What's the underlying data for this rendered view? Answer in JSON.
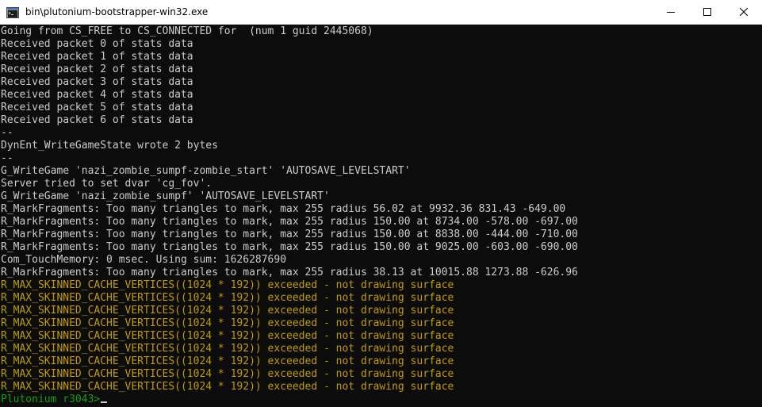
{
  "window": {
    "title": "bin\\plutonium-bootstrapper-win32.exe",
    "icon": "console-app-icon",
    "controls": {
      "minimize": "minimize-icon",
      "maximize": "maximize-icon",
      "close": "close-icon"
    }
  },
  "colors": {
    "background": "#0c0c0c",
    "text_default": "#cccccc",
    "text_warning": "#c19c00",
    "text_prompt": "#13a10e"
  },
  "console": {
    "lines": [
      {
        "text": "Going from CS_FREE to CS_CONNECTED for  (num 1 guid 2445068)",
        "style": "normal"
      },
      {
        "text": "Received packet 0 of stats data",
        "style": "normal"
      },
      {
        "text": "Received packet 1 of stats data",
        "style": "normal"
      },
      {
        "text": "Received packet 2 of stats data",
        "style": "normal"
      },
      {
        "text": "Received packet 3 of stats data",
        "style": "normal"
      },
      {
        "text": "Received packet 4 of stats data",
        "style": "normal"
      },
      {
        "text": "Received packet 5 of stats data",
        "style": "normal"
      },
      {
        "text": "Received packet 6 of stats data",
        "style": "normal"
      },
      {
        "text": "--",
        "style": "normal"
      },
      {
        "text": "DynEnt_WriteGameState wrote 2 bytes",
        "style": "normal"
      },
      {
        "text": "--",
        "style": "normal"
      },
      {
        "text": "G_WriteGame 'nazi_zombie_sumpf-zombie_start' 'AUTOSAVE_LEVELSTART'",
        "style": "normal"
      },
      {
        "text": "Server tried to set dvar 'cg_fov'.",
        "style": "normal"
      },
      {
        "text": "G_WriteGame 'nazi_zombie_sumpf' 'AUTOSAVE_LEVELSTART'",
        "style": "normal"
      },
      {
        "text": "R_MarkFragments: Too many triangles to mark, max 255 radius 56.02 at 9932.36 831.43 -649.00",
        "style": "normal"
      },
      {
        "text": "R_MarkFragments: Too many triangles to mark, max 255 radius 150.00 at 8734.00 -578.00 -697.00",
        "style": "normal"
      },
      {
        "text": "R_MarkFragments: Too many triangles to mark, max 255 radius 150.00 at 8838.00 -444.00 -710.00",
        "style": "normal"
      },
      {
        "text": "R_MarkFragments: Too many triangles to mark, max 255 radius 150.00 at 9025.00 -603.00 -690.00",
        "style": "normal"
      },
      {
        "text": "Com_TouchMemory: 0 msec. Using sum: 1626287690",
        "style": "normal"
      },
      {
        "text": "R_MarkFragments: Too many triangles to mark, max 255 radius 38.13 at 10015.88 1273.88 -626.96",
        "style": "normal"
      },
      {
        "text": "R_MAX_SKINNED_CACHE_VERTICES((1024 * 192)) exceeded - not drawing surface",
        "style": "warn"
      },
      {
        "text": "R_MAX_SKINNED_CACHE_VERTICES((1024 * 192)) exceeded - not drawing surface",
        "style": "warn"
      },
      {
        "text": "R_MAX_SKINNED_CACHE_VERTICES((1024 * 192)) exceeded - not drawing surface",
        "style": "warn"
      },
      {
        "text": "R_MAX_SKINNED_CACHE_VERTICES((1024 * 192)) exceeded - not drawing surface",
        "style": "warn"
      },
      {
        "text": "R_MAX_SKINNED_CACHE_VERTICES((1024 * 192)) exceeded - not drawing surface",
        "style": "warn"
      },
      {
        "text": "R_MAX_SKINNED_CACHE_VERTICES((1024 * 192)) exceeded - not drawing surface",
        "style": "warn"
      },
      {
        "text": "R_MAX_SKINNED_CACHE_VERTICES((1024 * 192)) exceeded - not drawing surface",
        "style": "warn"
      },
      {
        "text": "R_MAX_SKINNED_CACHE_VERTICES((1024 * 192)) exceeded - not drawing surface",
        "style": "warn"
      },
      {
        "text": "R_MAX_SKINNED_CACHE_VERTICES((1024 * 192)) exceeded - not drawing surface",
        "style": "warn"
      }
    ],
    "prompt": "Plutonium r3043>"
  }
}
